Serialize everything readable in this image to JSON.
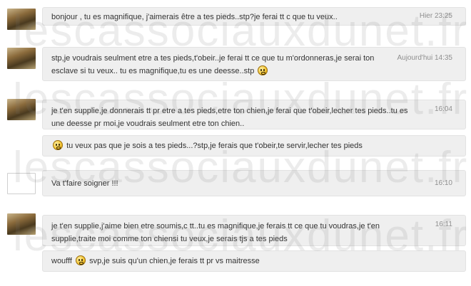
{
  "watermark": "lescassociauxdunet.fr",
  "messages": [
    {
      "text": "bonjour , tu es magnifique, j'aimerais être a tes pieds..stp?je ferai tt c que tu veux..",
      "time": "Hier 23:25"
    },
    {
      "text": "stp,je voudrais seulment etre a tes pieds,t'obeir..je ferai tt ce que tu m'ordonneras,je serai ton esclave si tu veux.. tu es magnifique,tu es une deesse..stp",
      "time": "Aujourd'hui 14:35"
    },
    {
      "text": "je t'en supplie,je donnerais tt pr etre a tes pieds,etre ton chien,je ferai que t'obeir,lecher tes pieds..tu es une deesse pr moi,je voudrais seulment etre ton chien..",
      "time": "16:04"
    },
    {
      "text": "tu veux pas que je sois a tes pieds...?stp,je ferais que t'obeir,te servir,lecher tes pieds",
      "time": ""
    },
    {
      "text": "Va t'faire soigner !!!",
      "time": "16:10"
    },
    {
      "text": "je t'en supplie,j'aime bien etre soumis,c tt..tu es magnifique,je ferais tt ce que tu voudras,je t'en supplie,traite moi comme ton chiensi tu veux,je serais tjs a tes pieds",
      "time": "16:11"
    },
    {
      "text_before": "woufff",
      "text_after": "svp,je suis qu'un chien,je ferais tt pr vs maitresse",
      "time": ""
    }
  ],
  "icons": {
    "avatar": "user-photo",
    "emoji": "smiley-icon"
  }
}
